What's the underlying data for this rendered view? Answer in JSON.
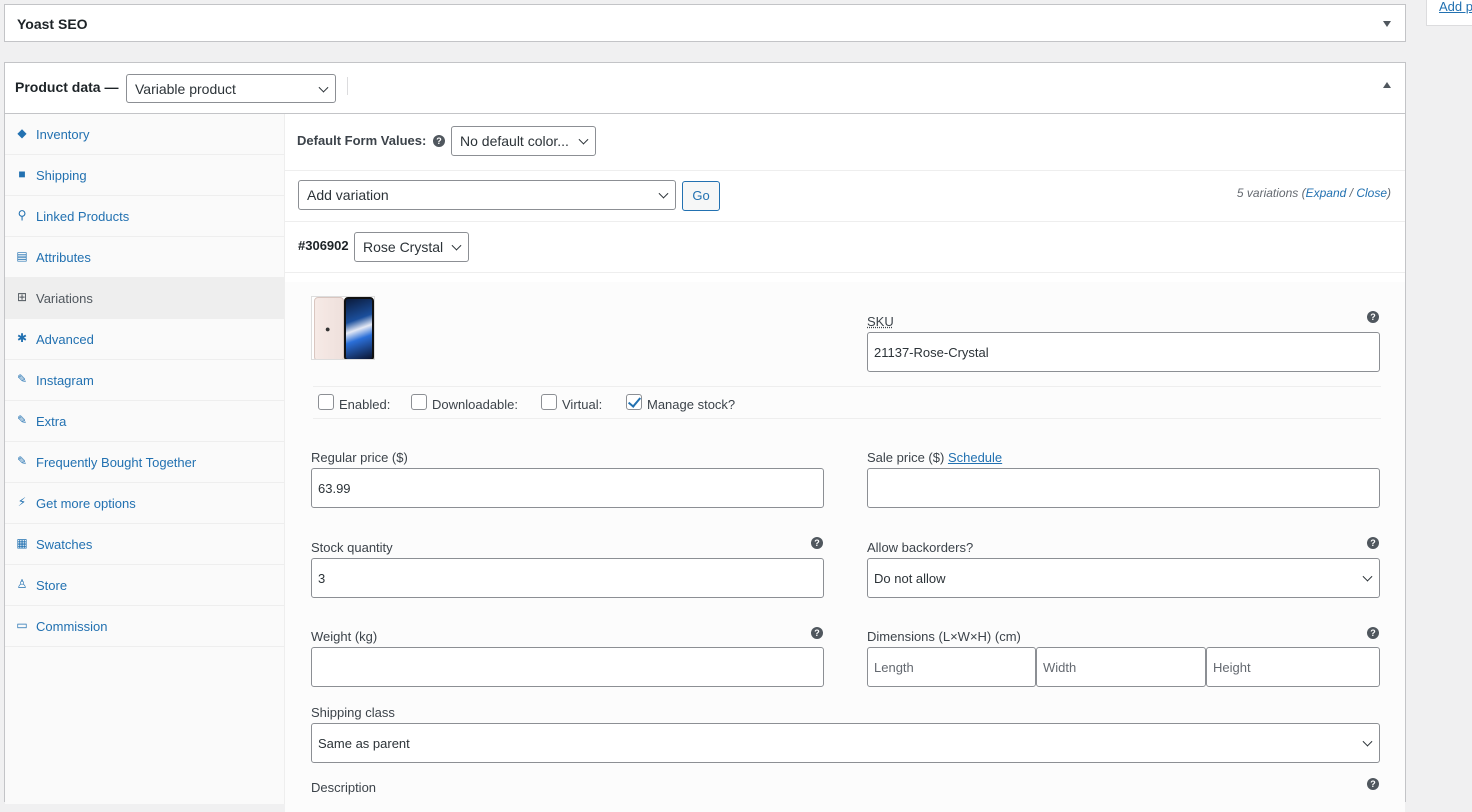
{
  "yoast": {
    "title": "Yoast SEO"
  },
  "sidebar_stub": {
    "link": "Add p"
  },
  "product_data": {
    "label": "Product data —",
    "type": "Variable product"
  },
  "tabs": [
    {
      "label": "Inventory",
      "icon": "tag-icon"
    },
    {
      "label": "Shipping",
      "icon": "truck-icon"
    },
    {
      "label": "Linked Products",
      "icon": "link-icon"
    },
    {
      "label": "Attributes",
      "icon": "list-icon"
    },
    {
      "label": "Variations",
      "icon": "grid-icon"
    },
    {
      "label": "Advanced",
      "icon": "gear-icon"
    },
    {
      "label": "Instagram",
      "icon": "wrench-icon"
    },
    {
      "label": "Extra",
      "icon": "wrench-icon"
    },
    {
      "label": "Frequently Bought Together",
      "icon": "wrench-icon"
    },
    {
      "label": "Get more options",
      "icon": "plugin-icon"
    },
    {
      "label": "Swatches",
      "icon": "grid-icon"
    },
    {
      "label": "Store",
      "icon": "store-icon"
    },
    {
      "label": "Commission",
      "icon": "card-icon"
    }
  ],
  "variations": {
    "default_form_label": "Default Form Values:",
    "default_form_value": "No default color...",
    "add_variation": "Add variation",
    "go": "Go",
    "count_text": "5 variations (",
    "expand": "Expand",
    "slash": " / ",
    "close": "Close",
    "count_end": ")",
    "variation_id": "#306902",
    "variation_attr": "Rose Crystal",
    "sku_label": "SKU",
    "sku_value": "21137-Rose-Crystal",
    "enabled": "Enabled:",
    "downloadable": "Downloadable:",
    "virtual": "Virtual:",
    "manage_stock": "Manage stock?",
    "regular_price_label": "Regular price ($)",
    "regular_price_value": "63.99",
    "sale_price_label": "Sale price ($)",
    "schedule": "Schedule",
    "stock_qty_label": "Stock quantity",
    "stock_qty_value": "3",
    "backorders_label": "Allow backorders?",
    "backorders_value": "Do not allow",
    "weight_label": "Weight (kg)",
    "dimensions_label": "Dimensions (L×W×H) (cm)",
    "length_ph": "Length",
    "width_ph": "Width",
    "height_ph": "Height",
    "shipping_class_label": "Shipping class",
    "shipping_class_value": "Same as parent",
    "description_label": "Description"
  },
  "colors": {
    "link": "#2271b1",
    "border": "#c3c4c7"
  }
}
